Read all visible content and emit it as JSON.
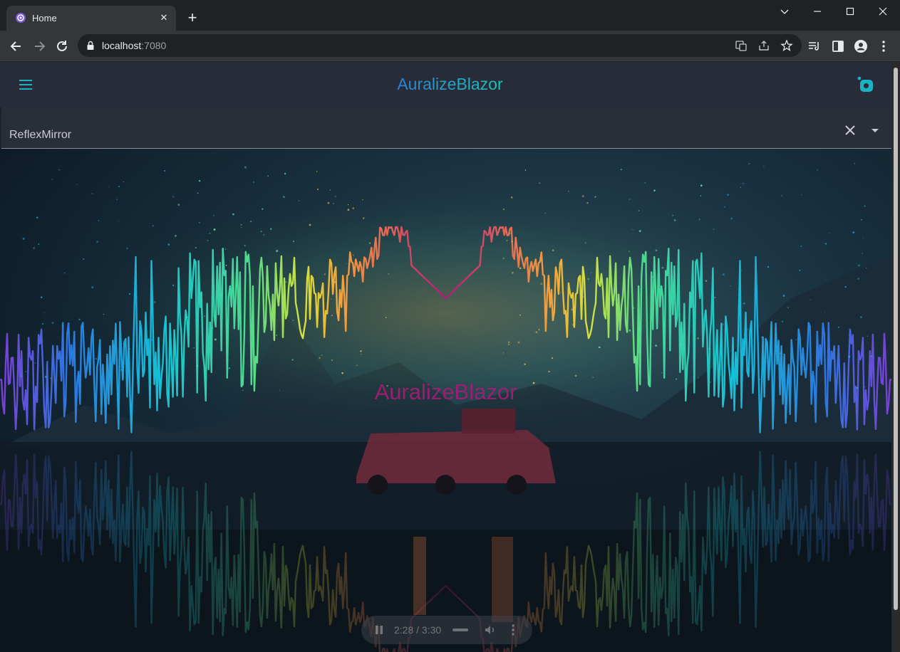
{
  "browser": {
    "tab_title": "Home",
    "tab_close": "✕",
    "new_tab": "+",
    "url_host": "localhost",
    "url_port": ":7080"
  },
  "app": {
    "brand": "AuralizeBlazor",
    "selected_visualizer": "ReflexMirror",
    "center_title": "AuralizeBlazor"
  },
  "player": {
    "time": "2:28 / 3:30"
  },
  "icons": {
    "menu": "hamburger-menu-icon",
    "github": "github-icon",
    "clear": "close-icon",
    "dropdown": "caret-down-icon"
  },
  "colors": {
    "accent": "#19b3c4",
    "center_title": "#b0197c",
    "appbar": "#272c38"
  }
}
